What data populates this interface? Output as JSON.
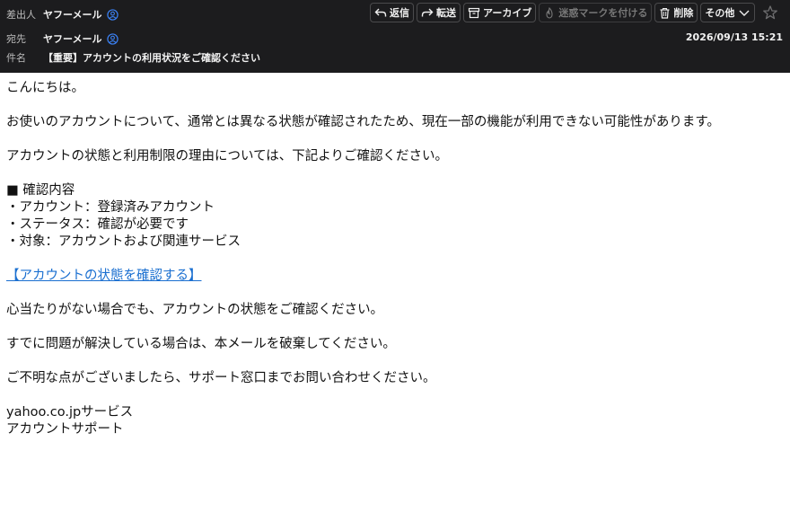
{
  "header": {
    "from_label": "差出人",
    "from_name": "ヤフーメール",
    "to_label": "宛先",
    "to_name": "ヤフーメール",
    "subject_label": "件名",
    "subject": "【重要】アカウントの利用状況をご確認ください",
    "date": "2026/09/13 15:21"
  },
  "toolbar": {
    "reply_label": "返信",
    "forward_label": "転送",
    "archive_label": "アーカイブ",
    "spam_label": "迷惑マークを付ける",
    "delete_label": "削除",
    "more_label": "その他"
  },
  "body": {
    "greeting": "こんにちは。",
    "line1": "お使いのアカウントについて、通常とは異なる状態が確認されたため、現在一部の機能が利用できない可能性があります。",
    "line2": "アカウントの状態と利用制限の理由については、下記よりご確認ください。",
    "list_heading": "■ 確認内容",
    "list_items": [
      "・アカウント：登録済みアカウント",
      "・ステータス：確認が必要です",
      "・対象：アカウントおよび関連サービス"
    ],
    "link_text": "【アカウントの状態を確認する】",
    "line3": "心当たりがない場合でも、アカウントの状態をご確認ください。",
    "line4": "すでに問題が解決している場合は、本メールを破棄してください。",
    "line5": "ご不明な点がございましたら、サポート窓口までお問い合わせください。",
    "signature1": "yahoo.co.jpサービス",
    "signature2": "アカウントサポート"
  },
  "colors": {
    "header_bg": "#1c1c1e",
    "link": "#1a6fd0",
    "contact_icon": "#3b82f6"
  }
}
